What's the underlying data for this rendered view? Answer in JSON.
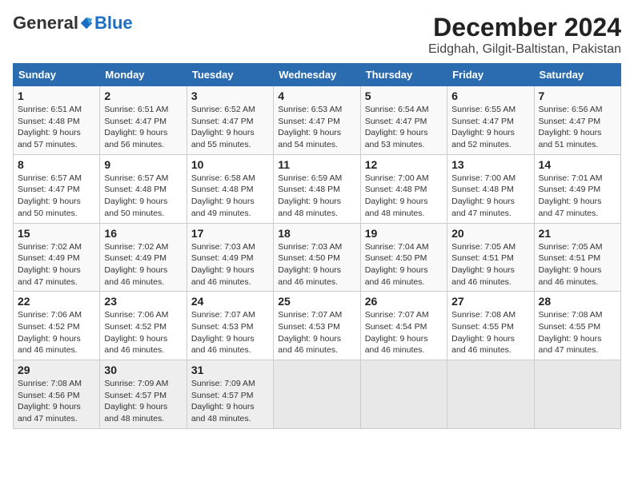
{
  "logo": {
    "general": "General",
    "blue": "Blue"
  },
  "title": "December 2024",
  "subtitle": "Eidghah, Gilgit-Baltistan, Pakistan",
  "days_of_week": [
    "Sunday",
    "Monday",
    "Tuesday",
    "Wednesday",
    "Thursday",
    "Friday",
    "Saturday"
  ],
  "weeks": [
    [
      {
        "day": 1,
        "sunrise": "6:51 AM",
        "sunset": "4:48 PM",
        "daylight": "9 hours and 57 minutes."
      },
      {
        "day": 2,
        "sunrise": "6:51 AM",
        "sunset": "4:47 PM",
        "daylight": "9 hours and 56 minutes."
      },
      {
        "day": 3,
        "sunrise": "6:52 AM",
        "sunset": "4:47 PM",
        "daylight": "9 hours and 55 minutes."
      },
      {
        "day": 4,
        "sunrise": "6:53 AM",
        "sunset": "4:47 PM",
        "daylight": "9 hours and 54 minutes."
      },
      {
        "day": 5,
        "sunrise": "6:54 AM",
        "sunset": "4:47 PM",
        "daylight": "9 hours and 53 minutes."
      },
      {
        "day": 6,
        "sunrise": "6:55 AM",
        "sunset": "4:47 PM",
        "daylight": "9 hours and 52 minutes."
      },
      {
        "day": 7,
        "sunrise": "6:56 AM",
        "sunset": "4:47 PM",
        "daylight": "9 hours and 51 minutes."
      }
    ],
    [
      {
        "day": 8,
        "sunrise": "6:57 AM",
        "sunset": "4:47 PM",
        "daylight": "9 hours and 50 minutes."
      },
      {
        "day": 9,
        "sunrise": "6:57 AM",
        "sunset": "4:48 PM",
        "daylight": "9 hours and 50 minutes."
      },
      {
        "day": 10,
        "sunrise": "6:58 AM",
        "sunset": "4:48 PM",
        "daylight": "9 hours and 49 minutes."
      },
      {
        "day": 11,
        "sunrise": "6:59 AM",
        "sunset": "4:48 PM",
        "daylight": "9 hours and 48 minutes."
      },
      {
        "day": 12,
        "sunrise": "7:00 AM",
        "sunset": "4:48 PM",
        "daylight": "9 hours and 48 minutes."
      },
      {
        "day": 13,
        "sunrise": "7:00 AM",
        "sunset": "4:48 PM",
        "daylight": "9 hours and 47 minutes."
      },
      {
        "day": 14,
        "sunrise": "7:01 AM",
        "sunset": "4:49 PM",
        "daylight": "9 hours and 47 minutes."
      }
    ],
    [
      {
        "day": 15,
        "sunrise": "7:02 AM",
        "sunset": "4:49 PM",
        "daylight": "9 hours and 47 minutes."
      },
      {
        "day": 16,
        "sunrise": "7:02 AM",
        "sunset": "4:49 PM",
        "daylight": "9 hours and 46 minutes."
      },
      {
        "day": 17,
        "sunrise": "7:03 AM",
        "sunset": "4:49 PM",
        "daylight": "9 hours and 46 minutes."
      },
      {
        "day": 18,
        "sunrise": "7:03 AM",
        "sunset": "4:50 PM",
        "daylight": "9 hours and 46 minutes."
      },
      {
        "day": 19,
        "sunrise": "7:04 AM",
        "sunset": "4:50 PM",
        "daylight": "9 hours and 46 minutes."
      },
      {
        "day": 20,
        "sunrise": "7:05 AM",
        "sunset": "4:51 PM",
        "daylight": "9 hours and 46 minutes."
      },
      {
        "day": 21,
        "sunrise": "7:05 AM",
        "sunset": "4:51 PM",
        "daylight": "9 hours and 46 minutes."
      }
    ],
    [
      {
        "day": 22,
        "sunrise": "7:06 AM",
        "sunset": "4:52 PM",
        "daylight": "9 hours and 46 minutes."
      },
      {
        "day": 23,
        "sunrise": "7:06 AM",
        "sunset": "4:52 PM",
        "daylight": "9 hours and 46 minutes."
      },
      {
        "day": 24,
        "sunrise": "7:07 AM",
        "sunset": "4:53 PM",
        "daylight": "9 hours and 46 minutes."
      },
      {
        "day": 25,
        "sunrise": "7:07 AM",
        "sunset": "4:53 PM",
        "daylight": "9 hours and 46 minutes."
      },
      {
        "day": 26,
        "sunrise": "7:07 AM",
        "sunset": "4:54 PM",
        "daylight": "9 hours and 46 minutes."
      },
      {
        "day": 27,
        "sunrise": "7:08 AM",
        "sunset": "4:55 PM",
        "daylight": "9 hours and 46 minutes."
      },
      {
        "day": 28,
        "sunrise": "7:08 AM",
        "sunset": "4:55 PM",
        "daylight": "9 hours and 47 minutes."
      }
    ],
    [
      {
        "day": 29,
        "sunrise": "7:08 AM",
        "sunset": "4:56 PM",
        "daylight": "9 hours and 47 minutes."
      },
      {
        "day": 30,
        "sunrise": "7:09 AM",
        "sunset": "4:57 PM",
        "daylight": "9 hours and 48 minutes."
      },
      {
        "day": 31,
        "sunrise": "7:09 AM",
        "sunset": "4:57 PM",
        "daylight": "9 hours and 48 minutes."
      },
      null,
      null,
      null,
      null
    ]
  ]
}
